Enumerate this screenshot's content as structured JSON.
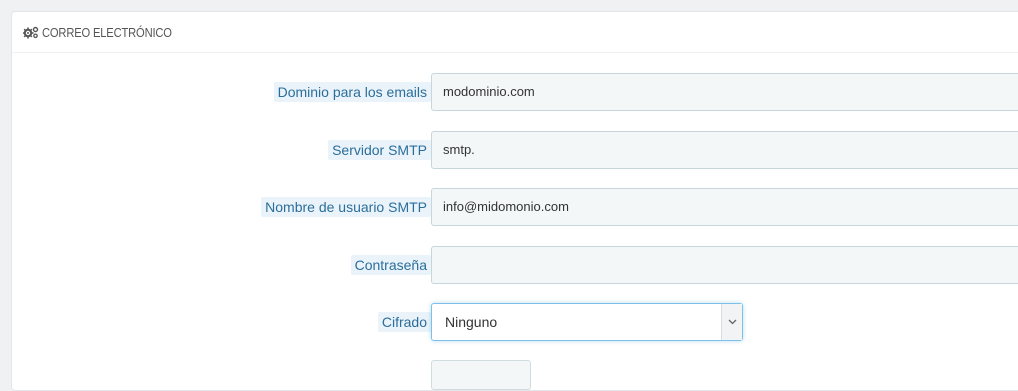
{
  "section": {
    "title": "CORREO ELECTRÓNICO",
    "icon": "cogs-icon"
  },
  "fields": [
    {
      "label": "Dominio para los emails",
      "value": "modominio.com"
    },
    {
      "label": "Servidor SMTP",
      "value": "smtp."
    },
    {
      "label": "Nombre de usuario SMTP",
      "value": "info@midomonio.com"
    },
    {
      "label": "Contraseña",
      "value": ""
    }
  ],
  "encryption": {
    "label": "Cifrado",
    "selected": "Ninguno"
  },
  "colors": {
    "label_text": "#2b6e9b",
    "label_bg": "#eaf3fa",
    "input_bg": "#f4f7f8",
    "focus_border": "#7fc0e6"
  }
}
